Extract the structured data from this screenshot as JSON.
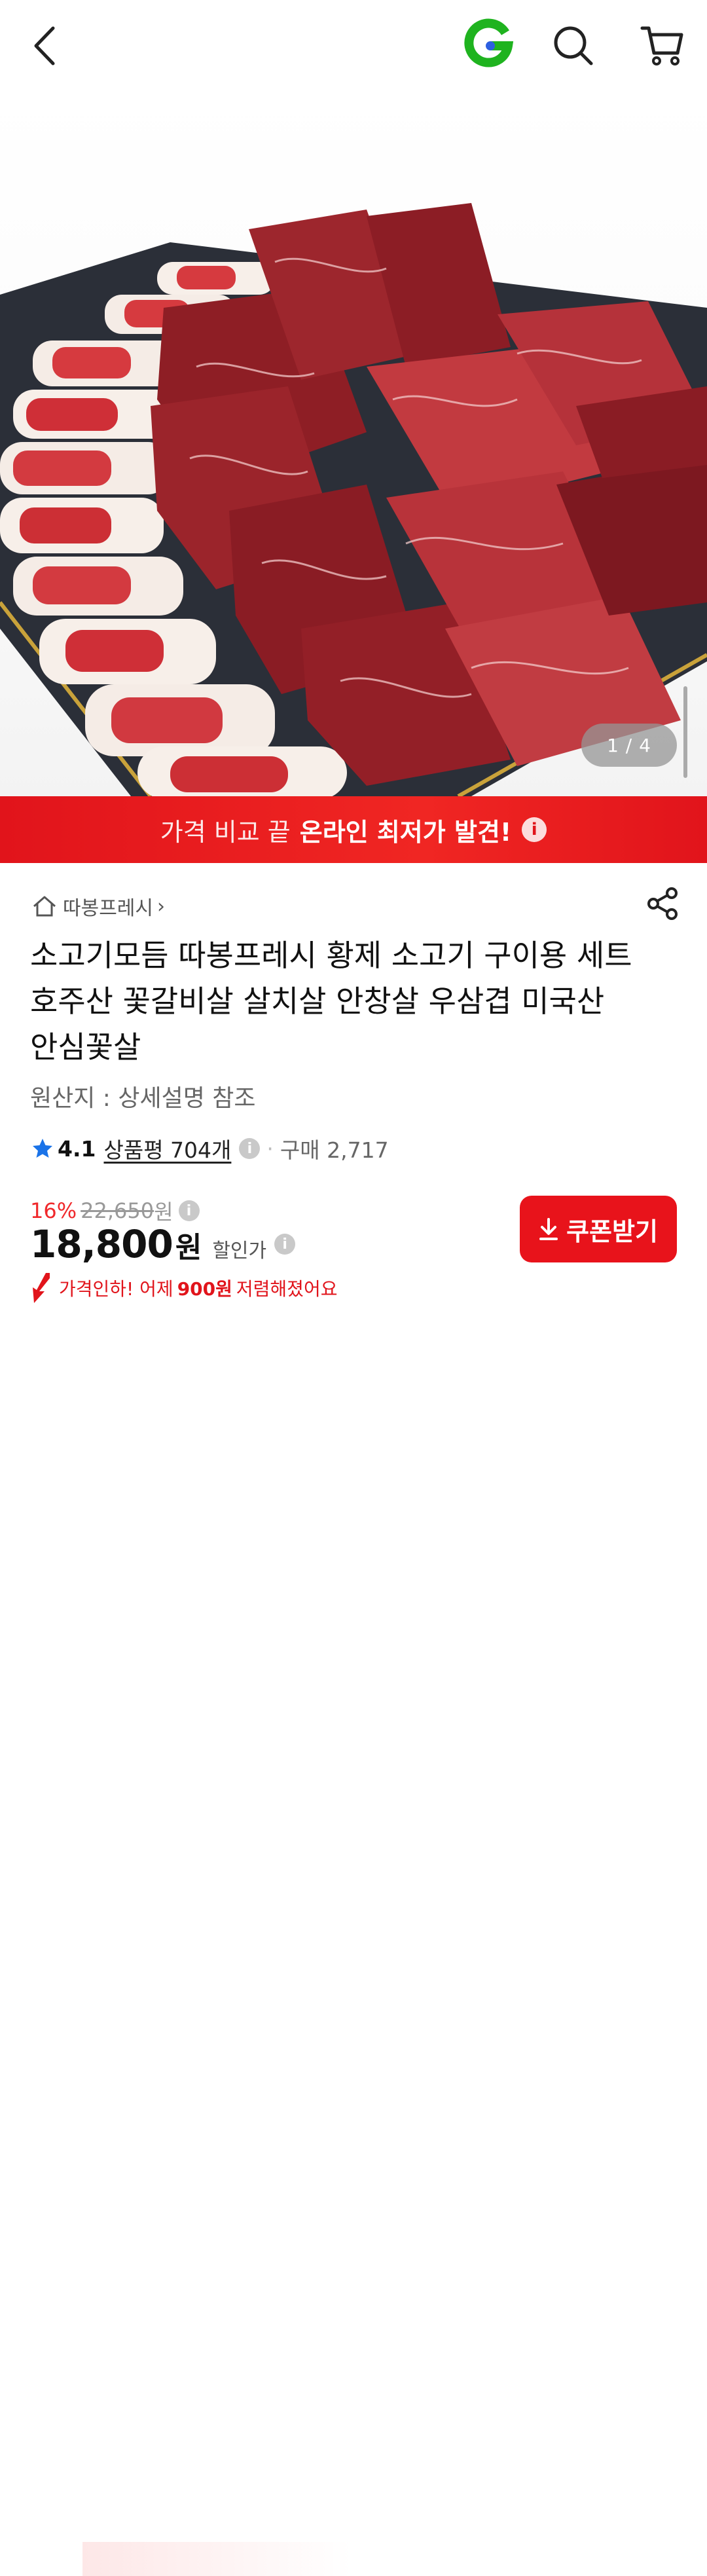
{
  "header": {
    "back_icon": "chevron-left-icon",
    "brand_icon": "g-logo-icon",
    "brand_color": "#1fb31f",
    "search_icon": "search-icon",
    "cart_icon": "cart-icon"
  },
  "gallery": {
    "image_alt": "beef barbecue set photo",
    "current": "1",
    "total": "4",
    "pager_text": "1 / 4"
  },
  "banner": {
    "light_text": "가격 비교 끝",
    "bold_text": "온라인 최저가 발견!",
    "info_icon": "i",
    "color": "#e1141b"
  },
  "product": {
    "store_name": "따봉프레시",
    "store_chevron": "›",
    "title": "소고기모듬 따봉프레시 황제 소고기 구이용 세트 호주산 꽃갈비살 살치살 안창살 우삼겹 미국산 안심꽃살",
    "origin": "원산지 : 상세설명 참조",
    "rating": "4.1",
    "reviews": "상품평 704개",
    "info_icon": "i",
    "dot": "·",
    "purchases": "구매 2,717"
  },
  "price": {
    "discount_pct": "16%",
    "original": "22,650",
    "original_unit": "원",
    "sale": "18,800",
    "sale_unit": "원",
    "sale_label": "할인가",
    "info_icon": "i"
  },
  "coupon": {
    "label": "쿠폰받기",
    "icon": "download-icon"
  },
  "price_drop": {
    "prefix": "가격인하! 어제",
    "amount": "900원",
    "suffix": "저렴해졌어요"
  }
}
